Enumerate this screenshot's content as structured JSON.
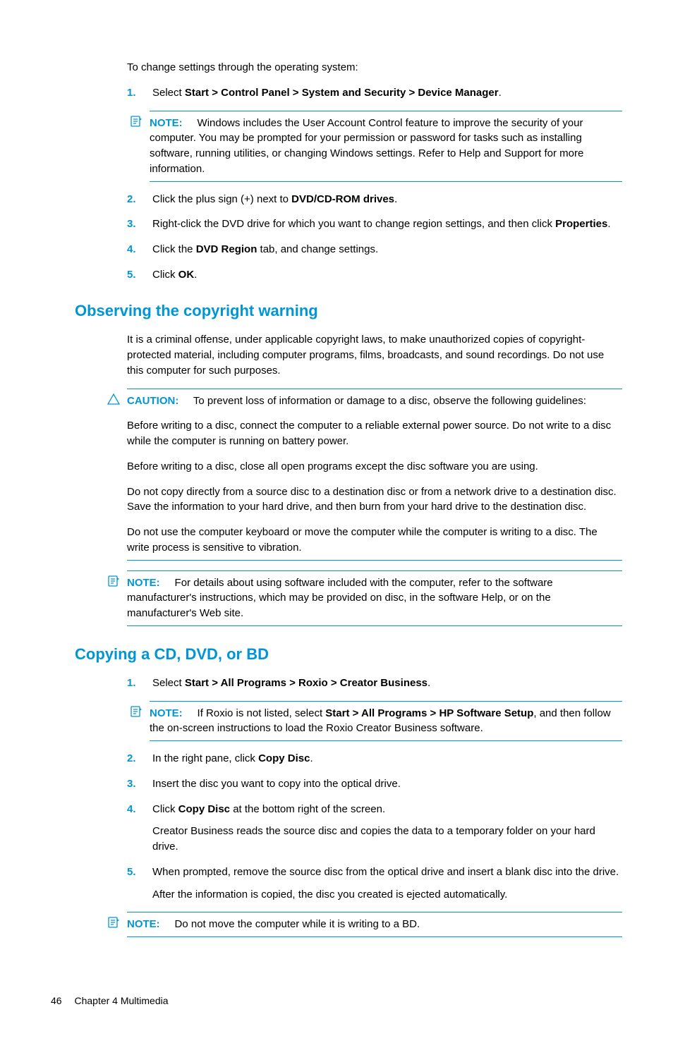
{
  "intro": "To change settings through the operating system:",
  "steps1": [
    {
      "n": "1.",
      "pre": "Select ",
      "bold": "Start > Control Panel > System and Security > Device Manager",
      "post": "."
    }
  ],
  "note1": {
    "label": "NOTE:",
    "text": "Windows includes the User Account Control feature to improve the security of your computer. You may be prompted for your permission or password for tasks such as installing software, running utilities, or changing Windows settings. Refer to Help and Support for more information."
  },
  "steps1b": [
    {
      "n": "2.",
      "pre": "Click the plus sign (+) next to ",
      "bold": "DVD/CD-ROM drives",
      "post": "."
    },
    {
      "n": "3.",
      "pre": "Right-click the DVD drive for which you want to change region settings, and then click ",
      "bold": "Properties",
      "post": "."
    },
    {
      "n": "4.",
      "pre": "Click the ",
      "bold": "DVD Region",
      "post": " tab, and change settings."
    },
    {
      "n": "5.",
      "pre": "Click ",
      "bold": "OK",
      "post": "."
    }
  ],
  "h2a": "Observing the copyright warning",
  "para_a": "It is a criminal offense, under applicable copyright laws, to make unauthorized copies of copyright-protected material, including computer programs, films, broadcasts, and sound recordings. Do not use this computer for such purposes.",
  "caution": {
    "label": "CAUTION:",
    "lead": "To prevent loss of information or damage to a disc, observe the following guidelines:",
    "p1": "Before writing to a disc, connect the computer to a reliable external power source. Do not write to a disc while the computer is running on battery power.",
    "p2": "Before writing to a disc, close all open programs except the disc software you are using.",
    "p3": "Do not copy directly from a source disc to a destination disc or from a network drive to a destination disc. Save the information to your hard drive, and then burn from your hard drive to the destination disc.",
    "p4": "Do not use the computer keyboard or move the computer while the computer is writing to a disc. The write process is sensitive to vibration."
  },
  "note2": {
    "label": "NOTE:",
    "text": "For details about using software included with the computer, refer to the software manufacturer's instructions, which may be provided on disc, in the software Help, or on the manufacturer's Web site."
  },
  "h2b": "Copying a CD, DVD, or BD",
  "steps2a": [
    {
      "n": "1.",
      "pre": "Select ",
      "bold": "Start > All Programs > Roxio > Creator Business",
      "post": "."
    }
  ],
  "note3": {
    "label": "NOTE:",
    "pre": "If Roxio is not listed, select ",
    "bold": "Start > All Programs > HP Software Setup",
    "post": ", and then follow the on-screen instructions to load the Roxio Creator Business software."
  },
  "steps2b": [
    {
      "n": "2.",
      "pre": "In the right pane, click ",
      "bold": "Copy Disc",
      "post": "."
    },
    {
      "n": "3.",
      "pre": "Insert the disc you want to copy into the optical drive.",
      "bold": "",
      "post": ""
    },
    {
      "n": "4.",
      "pre": "Click ",
      "bold": "Copy Disc",
      "post": " at the bottom right of the screen.",
      "extra": "Creator Business reads the source disc and copies the data to a temporary folder on your hard drive."
    },
    {
      "n": "5.",
      "pre": "When prompted, remove the source disc from the optical drive and insert a blank disc into the drive.",
      "bold": "",
      "post": "",
      "extra": "After the information is copied, the disc you created is ejected automatically."
    }
  ],
  "note4": {
    "label": "NOTE:",
    "text": "Do not move the computer while it is writing to a BD."
  },
  "footer": {
    "page": "46",
    "chapter": "Chapter 4   Multimedia"
  }
}
